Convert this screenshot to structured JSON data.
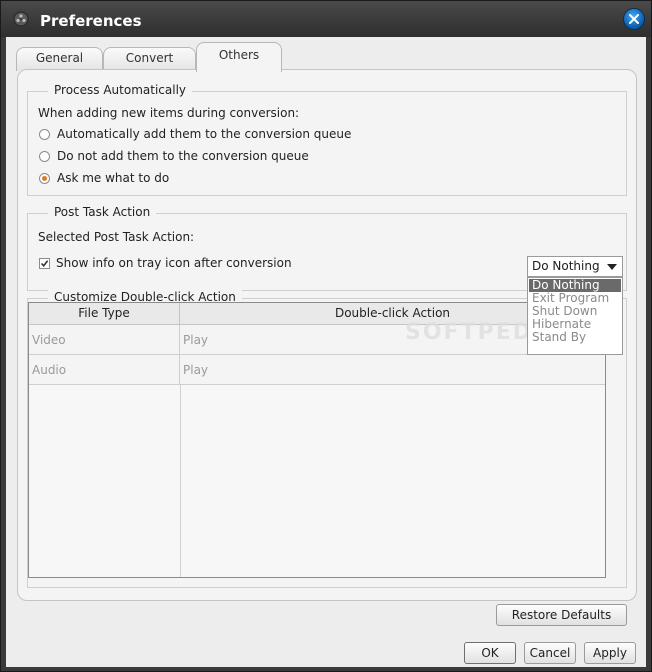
{
  "window": {
    "title": "Preferences",
    "icon": "app-icon",
    "close_icon": "close-icon"
  },
  "tabs": [
    {
      "label": "General",
      "active": false
    },
    {
      "label": "Convert",
      "active": false
    },
    {
      "label": "Others",
      "active": true
    }
  ],
  "process_auto": {
    "title": "Process Automatically",
    "prompt": "When adding new items during conversion:",
    "options": [
      {
        "label": "Automatically add them to the conversion queue",
        "checked": false
      },
      {
        "label": "Do not add them to the conversion queue",
        "checked": false
      },
      {
        "label": "Ask me what to do",
        "checked": true
      }
    ]
  },
  "post_task": {
    "title": "Post Task Action",
    "label": "Selected Post Task Action:",
    "selected": "Do Nothing",
    "options": [
      "Do Nothing",
      "Exit Program",
      "Shut Down",
      "Hibernate",
      "Stand By"
    ],
    "show_info_label": "Show info on tray icon after conversion",
    "show_info_checked": true
  },
  "double_click": {
    "title": "Customize Double-click Action",
    "columns": [
      "File Type",
      "Double-click Action"
    ],
    "rows": [
      [
        "Video",
        "Play"
      ],
      [
        "Audio",
        "Play"
      ]
    ]
  },
  "watermark": "SOFTPEDIA",
  "buttons": {
    "restore": "Restore Defaults",
    "ok": "OK",
    "cancel": "Cancel",
    "apply": "Apply"
  },
  "colors": {
    "accent_radio": "#e07a1f",
    "titlebar": "#3a3a3a",
    "close_button": "#1f7fd1",
    "dropdown_selected": "#6a6a6a"
  }
}
